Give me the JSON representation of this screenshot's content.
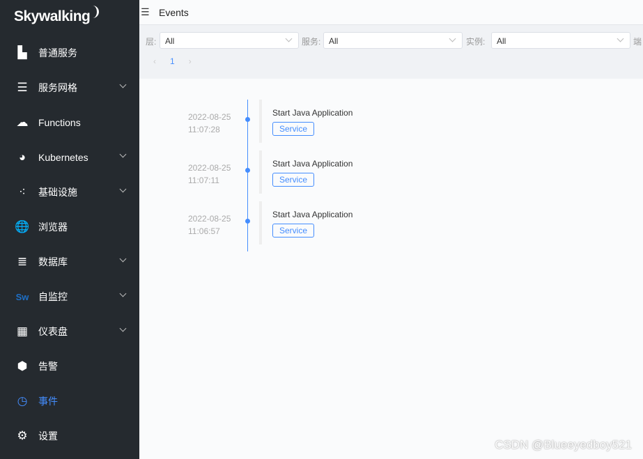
{
  "sidebar": {
    "logo": "Skywalking",
    "active_color": "#448dfe",
    "items": [
      {
        "label": "普通服务",
        "icon": "chart-icon",
        "expandable": false
      },
      {
        "label": "服务网格",
        "icon": "layers-icon",
        "expandable": true
      },
      {
        "label": "Functions",
        "icon": "cloud-icon",
        "expandable": false
      },
      {
        "label": "Kubernetes",
        "icon": "pie-icon",
        "expandable": true
      },
      {
        "label": "基础设施",
        "icon": "nodes-icon",
        "expandable": true
      },
      {
        "label": "浏览器",
        "icon": "globe-icon",
        "expandable": false
      },
      {
        "label": "数据库",
        "icon": "database-icon",
        "expandable": true
      },
      {
        "label": "自监控",
        "icon": "sw-icon",
        "expandable": true
      },
      {
        "label": "仪表盘",
        "icon": "dashboard-add-icon",
        "expandable": true
      },
      {
        "label": "告警",
        "icon": "alert-icon",
        "expandable": false
      },
      {
        "label": "事件",
        "icon": "timer-icon",
        "expandable": false,
        "active": true
      },
      {
        "label": "设置",
        "icon": "gear-icon",
        "expandable": false
      }
    ]
  },
  "header": {
    "title": "Events"
  },
  "filters": [
    {
      "label": "层:",
      "value": "All"
    },
    {
      "label": "服务:",
      "value": "All"
    },
    {
      "label": "实例:",
      "value": "All"
    },
    {
      "label": "端"
    }
  ],
  "pager": {
    "current": "1"
  },
  "events": [
    {
      "date": "2022-08-25",
      "time": "11:07:28",
      "name": "Start Java Application",
      "tag": "Service"
    },
    {
      "date": "2022-08-25",
      "time": "11:07:11",
      "name": "Start Java Application",
      "tag": "Service"
    },
    {
      "date": "2022-08-25",
      "time": "11:06:57",
      "name": "Start Java Application",
      "tag": "Service"
    }
  ],
  "watermark": "CSDN @Blueeyedboy521"
}
